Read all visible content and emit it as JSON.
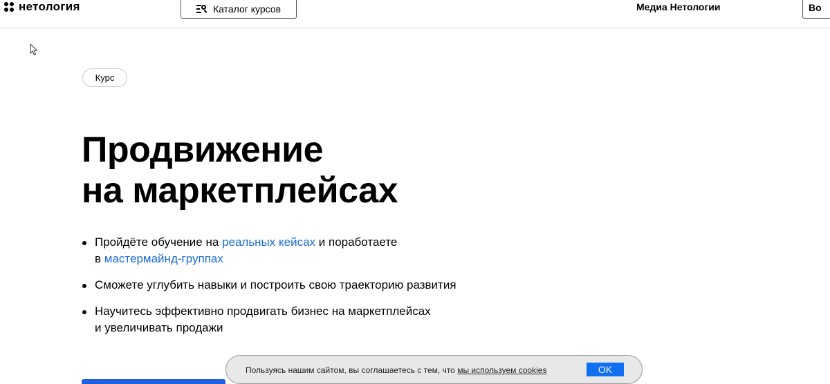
{
  "header": {
    "logo_text": "нетология",
    "catalog_label": "Каталог курсов",
    "media_label": "Медиа Нетологии",
    "right_button_label": "Во"
  },
  "hero": {
    "badge": "Курс",
    "title_line1": "Продвижение",
    "title_line2": "на маркетплейсах",
    "bullets": [
      {
        "part1": "Пройдёте обучение на ",
        "link1": "реальных кейсах",
        "part2": " и поработаете",
        "part3": "в ",
        "link2": "мастермайнд-группах"
      },
      {
        "text": "Сможете углубить навыки и построить свою траекторию развития"
      },
      {
        "line1": "Научитесь эффективно продвигать бизнес на маркетплейсах",
        "line2": "и увеличивать продажи"
      }
    ]
  },
  "cookie": {
    "text": "Пользуясь нашим сайтом, вы соглашаетесь с тем, что ",
    "link": "мы используем cookies",
    "ok_label": "OK"
  },
  "colors": {
    "link": "#1a6ad8",
    "accent": "#1170f2"
  },
  "icons": [
    "logo-icon",
    "catalog-search-icon",
    "mouse-cursor-icon"
  ]
}
